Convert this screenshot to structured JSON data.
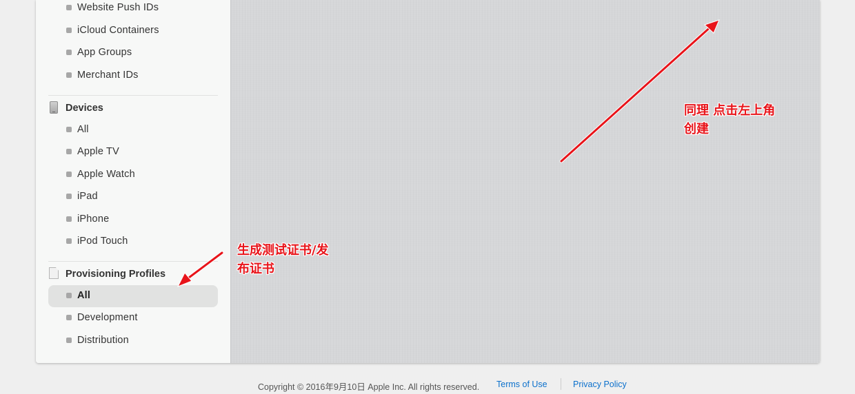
{
  "sidebar": {
    "identifier_items": [
      {
        "label": "Website Push IDs"
      },
      {
        "label": "iCloud Containers"
      },
      {
        "label": "App Groups"
      },
      {
        "label": "Merchant IDs"
      }
    ],
    "devices": {
      "title": "Devices",
      "icon": "phone-icon",
      "items": [
        {
          "label": "All"
        },
        {
          "label": "Apple TV"
        },
        {
          "label": "Apple Watch"
        },
        {
          "label": "iPad"
        },
        {
          "label": "iPhone"
        },
        {
          "label": "iPod Touch"
        }
      ]
    },
    "profiles": {
      "title": "Provisioning Profiles",
      "icon": "document-icon",
      "items": [
        {
          "label": "All",
          "active": true
        },
        {
          "label": "Development"
        },
        {
          "label": "Distribution"
        }
      ]
    }
  },
  "annotations": {
    "top_right": "同理 点击左上角\n创建",
    "profiles": "生成测试证书/发\n布证书",
    "color": "#e8141a"
  },
  "footer": {
    "copyright": "Copyright © 2016年9月10日 Apple Inc. All rights reserved.",
    "terms": "Terms of Use",
    "privacy": "Privacy Policy"
  }
}
